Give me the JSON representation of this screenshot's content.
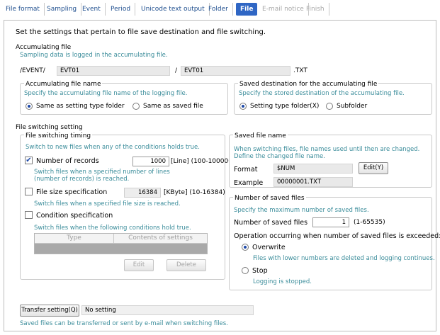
{
  "tabs": [
    {
      "label": "File format",
      "state": "normal"
    },
    {
      "label": "Sampling",
      "state": "normal"
    },
    {
      "label": "Event",
      "state": "normal"
    },
    {
      "label": "Period",
      "state": "normal"
    },
    {
      "label": "Unicode text output",
      "state": "normal"
    },
    {
      "label": "Folder",
      "state": "normal"
    },
    {
      "label": "File",
      "state": "active"
    },
    {
      "label": "E-mail notice",
      "state": "disabled"
    },
    {
      "label": "Finish",
      "state": "disabled"
    }
  ],
  "heading": "Set the settings that pertain to file save destination and file switching.",
  "accumulating": {
    "title": "Accumulating file",
    "hint": "Sampling data is logged in the accumulating file.",
    "path_prefix": "/EVENT/",
    "folder_value": "EVT01",
    "slash": "/",
    "file_value": "EVT01",
    "ext": ".TXT",
    "name_group": {
      "title": "Accumulating file name",
      "hint": "Specify the accumulating file name of the logging file.",
      "opt1": "Same as setting type folder",
      "opt2": "Same as saved file"
    },
    "dest_group": {
      "title": "Saved destination for the accumulating file",
      "hint": "Specify the stored destination of the accumulating file.",
      "opt1": "Setting type folder(X)",
      "opt2": "Subfolder"
    }
  },
  "switching": {
    "title": "File switching setting",
    "timing": {
      "title": "File switching timing",
      "hint": "Switch to new files when any of the conditions holds true.",
      "records_label": "Number of records",
      "records_value": "1000",
      "records_unit": "[Line] (100-100000)",
      "records_hint1": "Switch files when a specified number of lines",
      "records_hint2": "(number of records) is reached.",
      "size_label": "File size specification",
      "size_value": "16384",
      "size_unit": "[KByte] (10-16384)",
      "size_hint": "Switch files when a specified file size is reached.",
      "cond_label": "Condition specification",
      "cond_hint": "Switch files when the following conditions hold true.",
      "col_type": "Type",
      "col_contents": "Contents of settings",
      "edit_btn": "Edit",
      "delete_btn": "Delete"
    },
    "saved_name": {
      "title": "Saved file name",
      "hint1": "When switching files, file names used until then are changed.",
      "hint2": "Define the changed file name.",
      "format_label": "Format",
      "format_value": "$NUM",
      "edit_btn": "Edit(Y)",
      "example_label": "Example",
      "example_value": "00000001.TXT"
    },
    "saved_count": {
      "title": "Number of saved files",
      "hint": "Specify the maximum number of saved files.",
      "num_label": "Number of saved files",
      "num_value": "1",
      "num_range": "(1-65535)",
      "op_label": "Operation occurring when number of saved files is exceeded:",
      "overwrite": "Overwrite",
      "overwrite_hint": "Files with lower numbers are deleted and logging continues.",
      "stop": "Stop",
      "stop_hint": "Logging is stopped."
    }
  },
  "transfer": {
    "button": "Transfer setting(Q)",
    "value": "No setting",
    "hint": "Saved files can be transferred or sent by e-mail when switching files."
  }
}
